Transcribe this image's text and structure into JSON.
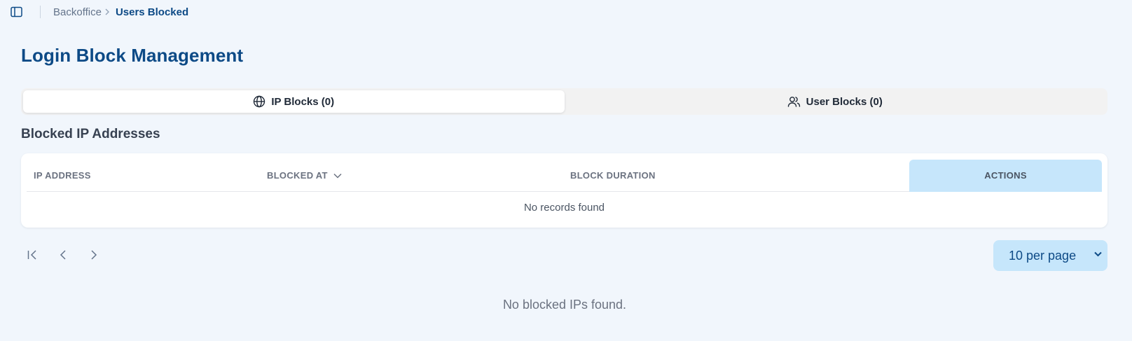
{
  "breadcrumb": {
    "parent": "Backoffice",
    "current": "Users Blocked"
  },
  "page": {
    "title": "Login Block Management"
  },
  "tabs": [
    {
      "label": "IP Blocks (0)",
      "icon": "globe-icon",
      "active": true
    },
    {
      "label": "User Blocks (0)",
      "icon": "users-icon",
      "active": false
    }
  ],
  "section": {
    "title": "Blocked IP Addresses"
  },
  "table": {
    "columns": [
      "IP ADDRESS",
      "BLOCKED AT",
      "BLOCK DURATION",
      "ACTIONS"
    ],
    "sorted_column": "BLOCKED AT",
    "sort_direction": "desc",
    "empty_text": "No records found",
    "rows": []
  },
  "pagination": {
    "per_page": "10 per page"
  },
  "empty_message": "No blocked IPs found.",
  "colors": {
    "background": "#f1f6fc",
    "brand": "#0d4a86",
    "accent_light": "#c6e6fb"
  }
}
